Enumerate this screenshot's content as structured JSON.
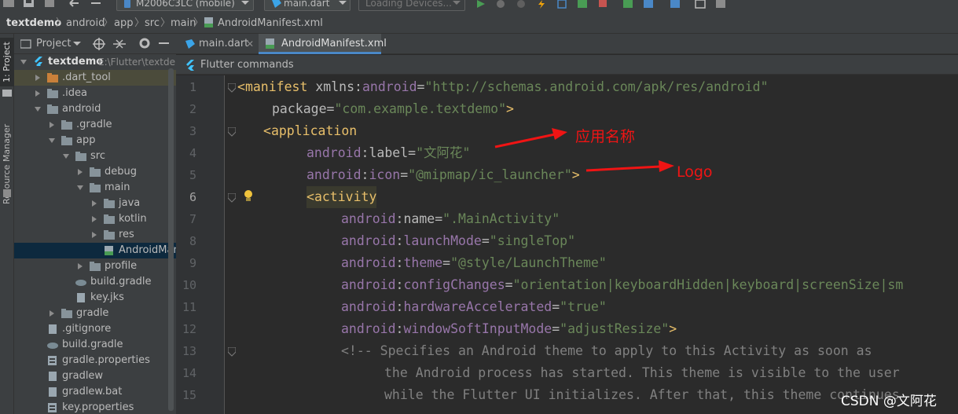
{
  "toolbar": {
    "device": "M2006C3LC (mobile)",
    "run_config": "main.dart",
    "loading": "Loading Devices..."
  },
  "breadcrumb": [
    "textdemo",
    "android",
    "app",
    "src",
    "main",
    "AndroidManifest.xml"
  ],
  "sidebar_tabs": [
    "1: Project",
    "Resource Manager"
  ],
  "project_panel": {
    "title": "Project",
    "root": "textdemo",
    "root_path": "E:\\Flutter\\textdem",
    "items": [
      {
        "label": ".dart_tool",
        "icon": "folder-orange"
      },
      {
        "label": ".idea",
        "icon": "folder"
      },
      {
        "label": "android",
        "icon": "folder"
      },
      {
        "label": ".gradle",
        "icon": "folder"
      },
      {
        "label": "app",
        "icon": "folder"
      },
      {
        "label": "src",
        "icon": "folder"
      },
      {
        "label": "debug",
        "icon": "folder"
      },
      {
        "label": "main",
        "icon": "folder"
      },
      {
        "label": "java",
        "icon": "folder"
      },
      {
        "label": "kotlin",
        "icon": "folder"
      },
      {
        "label": "res",
        "icon": "folder"
      },
      {
        "label": "AndroidMani",
        "icon": "manifest-file"
      },
      {
        "label": "profile",
        "icon": "folder"
      },
      {
        "label": "build.gradle",
        "icon": "gradle-file"
      },
      {
        "label": "key.jks",
        "icon": "file"
      },
      {
        "label": "gradle",
        "icon": "folder"
      },
      {
        "label": ".gitignore",
        "icon": "file"
      },
      {
        "label": "build.gradle",
        "icon": "gradle-file"
      },
      {
        "label": "gradle.properties",
        "icon": "properties-file"
      },
      {
        "label": "gradlew",
        "icon": "file"
      },
      {
        "label": "gradlew.bat",
        "icon": "file"
      },
      {
        "label": "key.properties",
        "icon": "properties-file"
      }
    ]
  },
  "tabs": [
    {
      "label": "main.dart",
      "icon": "dart-icon",
      "active": false
    },
    {
      "label": "AndroidManifest.xml",
      "icon": "manifest-icon",
      "active": true
    }
  ],
  "flutter_commands": "Flutter commands",
  "line_numbers": [
    "1",
    "2",
    "3",
    "4",
    "5",
    "6",
    "7",
    "8",
    "9",
    "10",
    "11",
    "12",
    "13",
    "14",
    "15"
  ],
  "current_line": "6",
  "code": {
    "l1": {
      "lt": "<",
      "tag": "manifest",
      "attr": "xmlns",
      "colon": ":",
      "ns": "android",
      "eq": "=",
      "val": "\"http://schemas.android.com/apk/res/android\""
    },
    "l2": {
      "attr": "package",
      "eq": "=",
      "val": "\"com.example.textdemo\"",
      "gt": ">"
    },
    "l3": {
      "lt": "<",
      "tag": "application"
    },
    "l4": {
      "ns": "android",
      "colon": ":",
      "attr": "label",
      "eq": "=",
      "val": "\"文阿花\""
    },
    "l5": {
      "ns": "android",
      "colon": ":",
      "attr": "icon",
      "eq": "=",
      "val": "\"@mipmap/ic_launcher\"",
      "gt": ">"
    },
    "l6": {
      "lt": "<",
      "tag": "activity"
    },
    "l7": {
      "ns": "android",
      "colon": ":",
      "attr": "name",
      "eq": "=",
      "val": "\".MainActivity\""
    },
    "l8": {
      "ns": "android",
      "colon": ":",
      "attr": "launchMode",
      "eq": "=",
      "val": "\"singleTop\""
    },
    "l9": {
      "ns": "android",
      "colon": ":",
      "attr": "theme",
      "eq": "=",
      "val": "\"@style/LaunchTheme\""
    },
    "l10": {
      "ns": "android",
      "colon": ":",
      "attr": "configChanges",
      "eq": "=",
      "val": "\"orientation|keyboardHidden|keyboard|screenSize|sm"
    },
    "l11": {
      "ns": "android",
      "colon": ":",
      "attr": "hardwareAccelerated",
      "eq": "=",
      "val": "\"true\""
    },
    "l12": {
      "ns": "android",
      "colon": ":",
      "attr": "windowSoftInputMode",
      "eq": "=",
      "val": "\"adjustResize\"",
      "gt": ">"
    },
    "l13": "<!-- Specifies an Android theme to apply to this Activity as soon as",
    "l14": "the Android process has started. This theme is visible to the user",
    "l15": "while the Flutter UI initializes. After that, this theme continues"
  },
  "annotations": {
    "app_name": "应用名称",
    "logo": "Logo"
  },
  "watermark": "CSDN @文阿花",
  "colors": {
    "accent": "#4a88c7",
    "annotation": "#f01414",
    "tag": "#e8bf6a",
    "namespace": "#9876aa",
    "value": "#6a8759",
    "comment": "#808080"
  }
}
